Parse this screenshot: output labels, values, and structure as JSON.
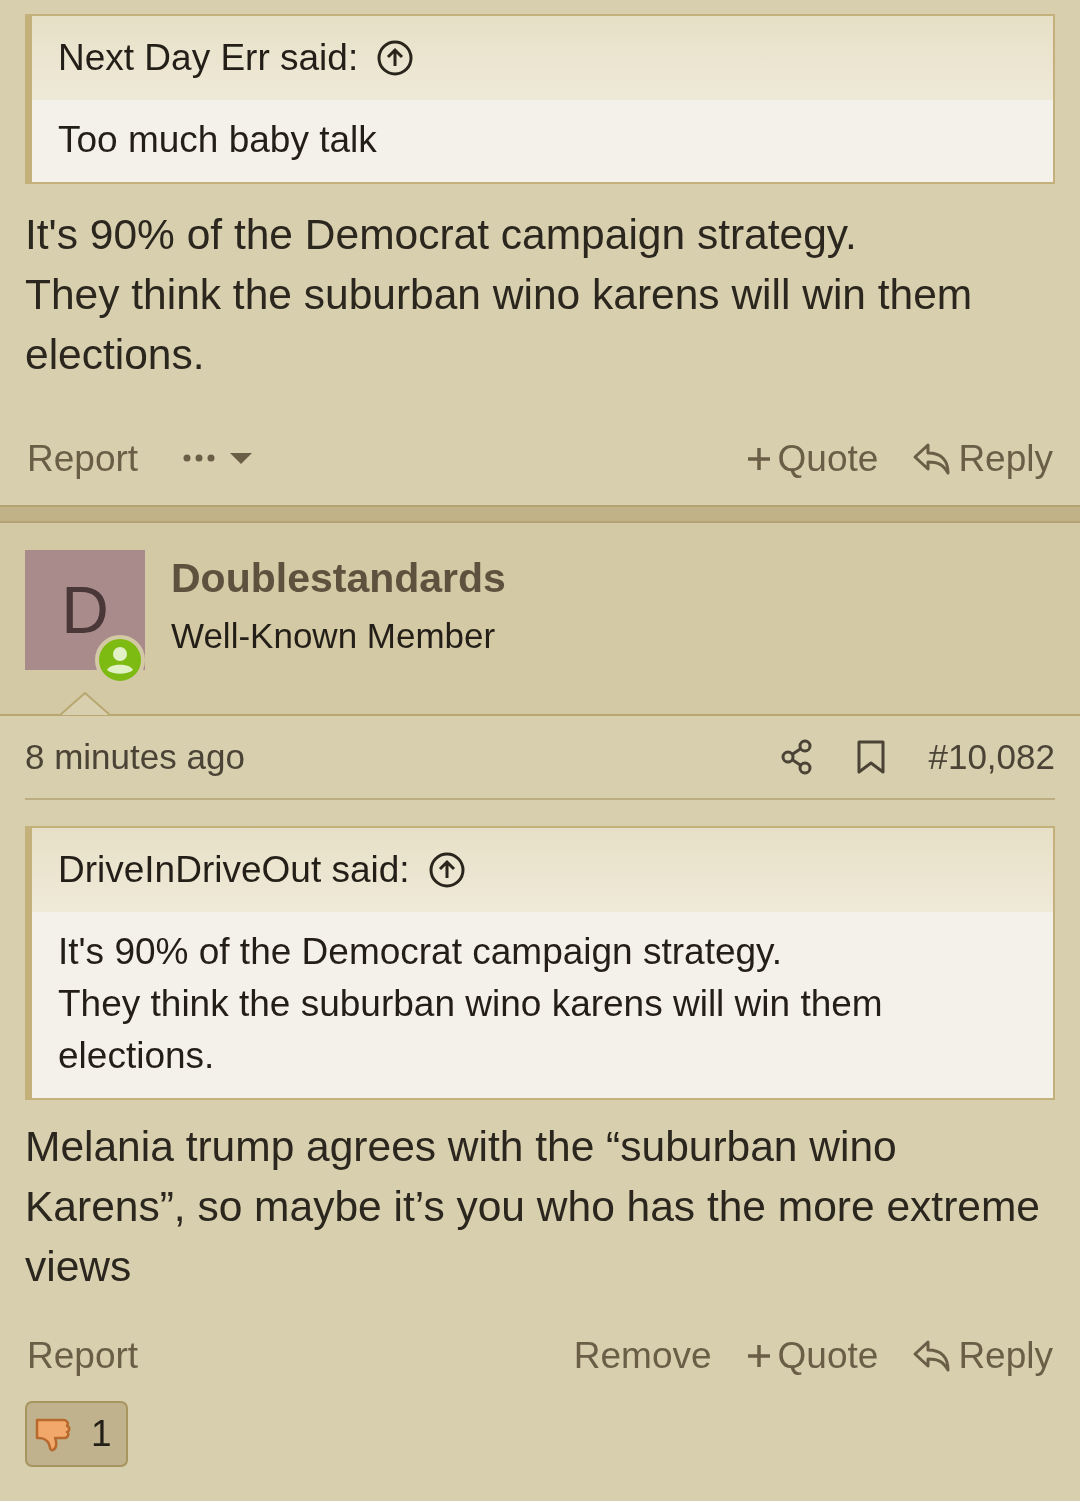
{
  "posts": [
    {
      "quote": {
        "attribution": "Next Day Err said:",
        "lines": [
          "Too much baby talk"
        ]
      },
      "body": [
        "It's 90% of the Democrat campaign strategy.",
        "They think the suburban wino karens will win them elections."
      ],
      "actions_left": [
        {
          "kind": "text",
          "label": "Report"
        },
        {
          "kind": "more"
        }
      ],
      "actions_right": [
        {
          "kind": "quote",
          "label": "Quote"
        },
        {
          "kind": "reply",
          "label": "Reply"
        }
      ]
    },
    {
      "user": {
        "avatar_letter": "D",
        "name": "Doublestandards",
        "title": "Well-Known Member",
        "online": true
      },
      "time": "8 minutes ago",
      "number": "#10,082",
      "quote": {
        "attribution": "DriveInDriveOut said:",
        "lines": [
          "It's 90% of the Democrat campaign strategy.",
          "They think the suburban wino karens will win them elections."
        ]
      },
      "body": [
        "Melania trump agrees with the “suburban wino Karens”, so maybe it’s you who has the more extreme views"
      ],
      "actions_left": [
        {
          "kind": "text",
          "label": "Report"
        }
      ],
      "actions_right": [
        {
          "kind": "text",
          "label": "Remove"
        },
        {
          "kind": "quote",
          "label": "Quote"
        },
        {
          "kind": "reply",
          "label": "Reply"
        }
      ],
      "reactions": [
        {
          "kind": "dislike",
          "count": "1"
        }
      ]
    }
  ]
}
